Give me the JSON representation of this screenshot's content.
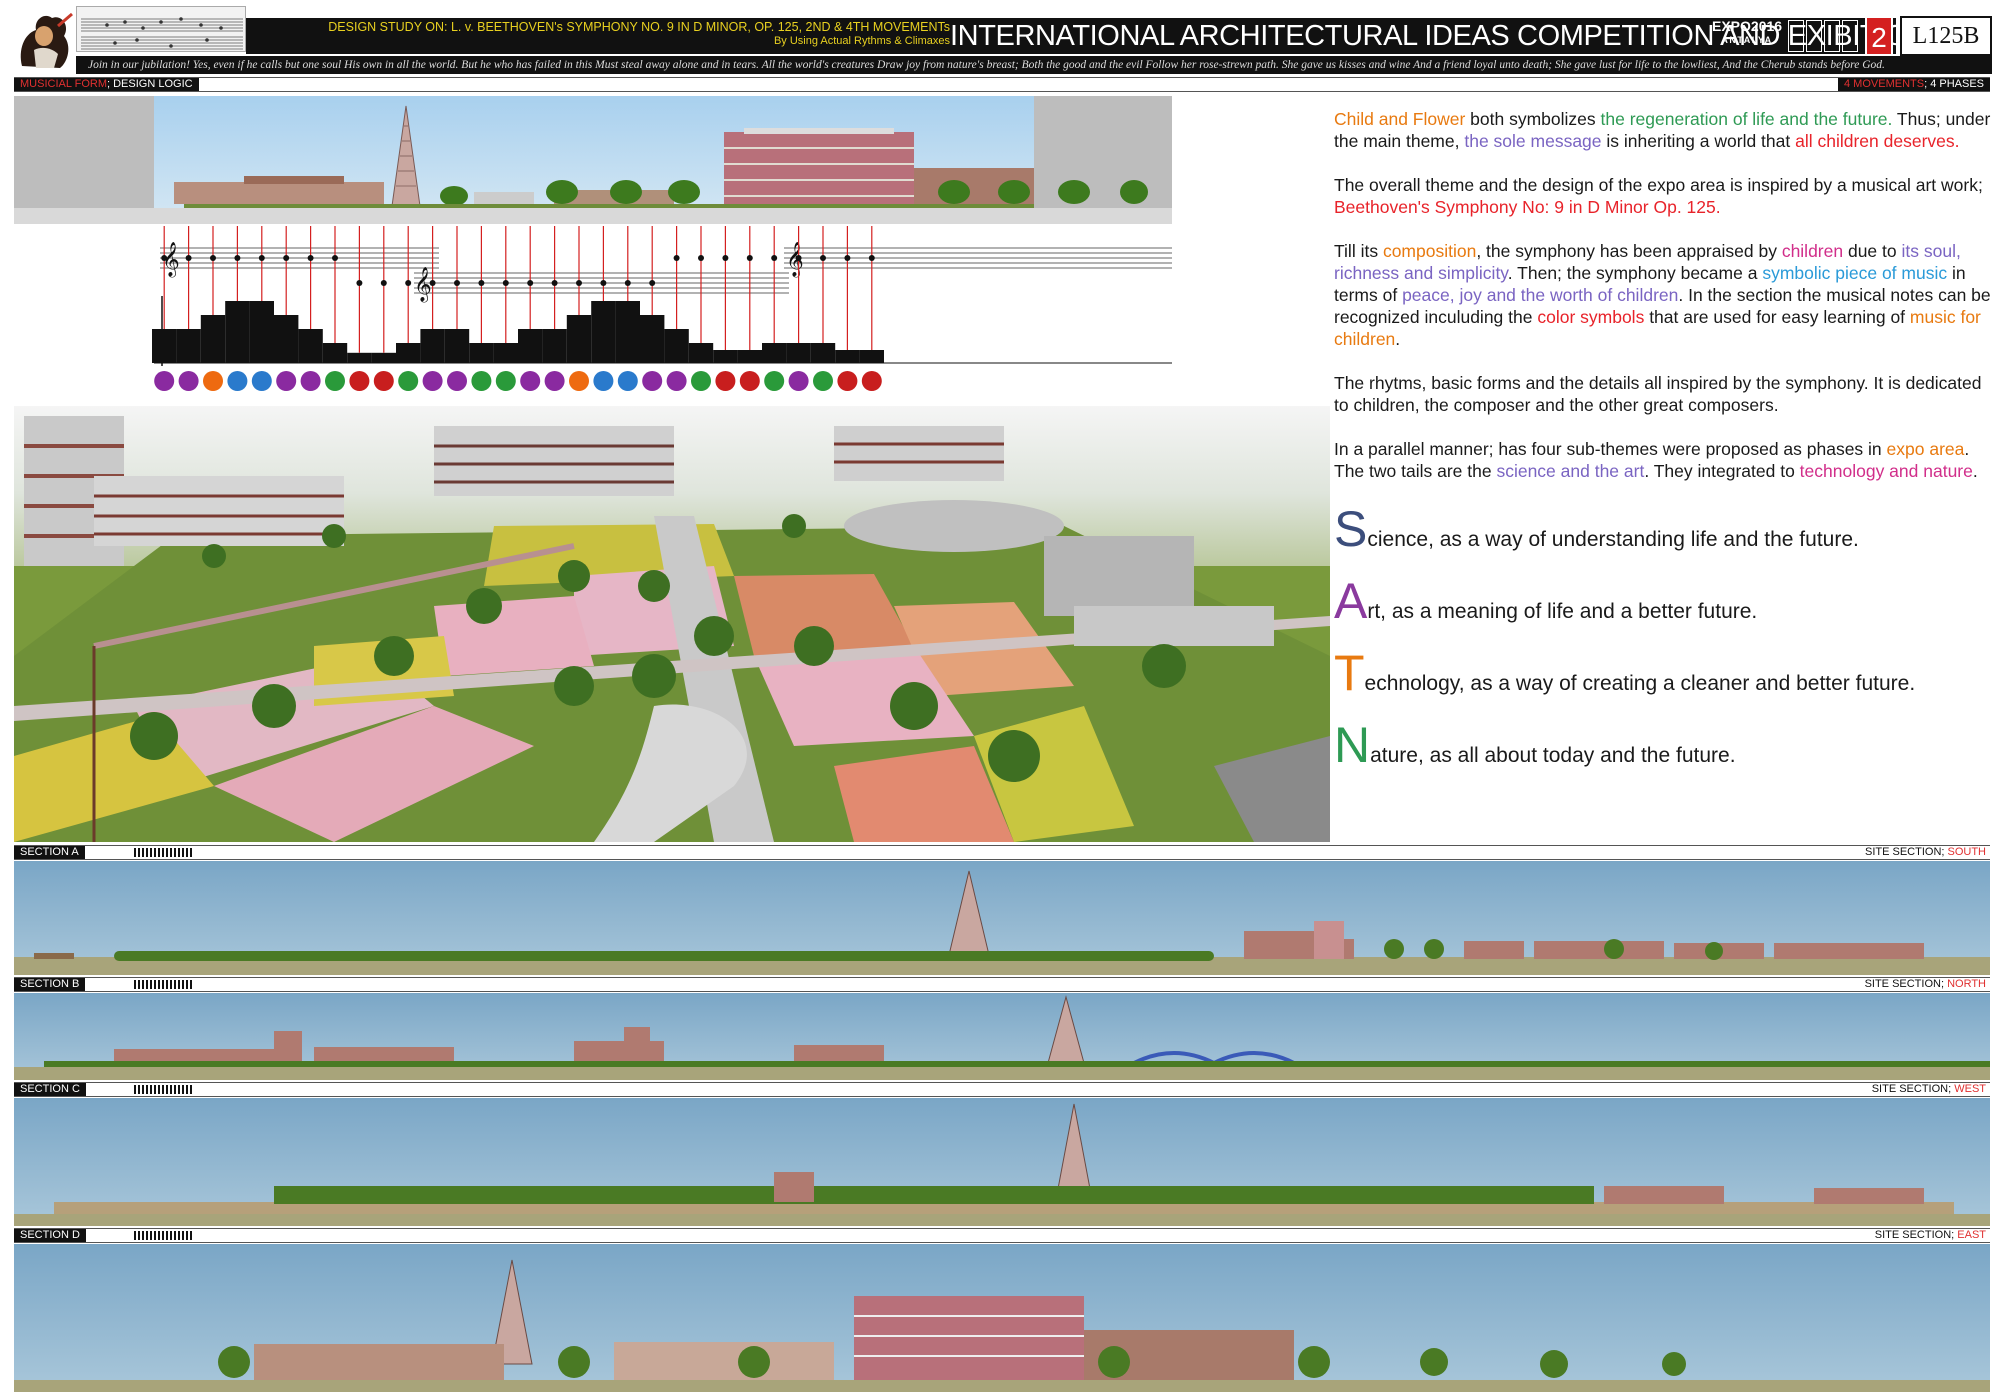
{
  "header": {
    "study_line": "DESIGN STUDY ON: L. v. BEETHOVEN's SYMPHONY NO. 9 IN D MINOR, OP. 125, 2ND & 4TH MOVEMENTs",
    "study_sub": "By Using Actual Rythms & Climaxes",
    "competition_title": "INTERNATIONAL ARCHITECTURAL IDEAS COMPETITION AND EXIBITION",
    "expo_year": "EXPO2016",
    "expo_city": "ANTALYA",
    "sheet_number": "2",
    "sheet_code": "L125B",
    "ode_text": "Join in our jubilation! Yes, even if he calls but one soul His own in all the world. But he who has failed in this Must steal away alone and in tears. All the world's creatures Draw joy from nature's breast; Both the good and the evil Follow her rose-strewn path. She gave us kisses and wine And a friend loyal unto death; She gave lust for life to the lowliest, And the Cherub stands before God."
  },
  "labels": {
    "top_left_a": "MUSICIAL FORM",
    "top_left_b": "; DESIGN LOGIC",
    "top_right_a": "4 MOVEMENTS",
    "top_right_b": "; 4 PHASES"
  },
  "text_panel": {
    "p1": [
      {
        "t": "Child and Flower",
        "c": "c-orange"
      },
      {
        "t": " both symbolizes ",
        "c": ""
      },
      {
        "t": "the regeneration of life and the future.",
        "c": "c-green"
      },
      {
        "t": " Thus; under the main theme, ",
        "c": ""
      },
      {
        "t": "the sole message",
        "c": "c-purple"
      },
      {
        "t": " is inheriting a world that ",
        "c": ""
      },
      {
        "t": "all children deserves.",
        "c": "c-red"
      }
    ],
    "p2": [
      {
        "t": "The overall theme and the design of the expo area is inspired by a musical art work; ",
        "c": ""
      },
      {
        "t": "Beethoven's Symphony No: 9 in D Minor Op. 125.",
        "c": "c-red"
      }
    ],
    "p3": [
      {
        "t": "Till its ",
        "c": ""
      },
      {
        "t": "composition",
        "c": "c-orange"
      },
      {
        "t": ", the symphony has been appraised by ",
        "c": ""
      },
      {
        "t": "children",
        "c": "c-magenta"
      },
      {
        "t": " due to ",
        "c": ""
      },
      {
        "t": "its soul, richness and simplicity",
        "c": "c-purple"
      },
      {
        "t": ". Then; the symphony became a ",
        "c": ""
      },
      {
        "t": "symbolic piece of music",
        "c": "c-blue"
      },
      {
        "t": " in terms of ",
        "c": ""
      },
      {
        "t": "peace, joy and the worth of children",
        "c": "c-purple"
      },
      {
        "t": ". In the section the musical notes can be recognized inculuding the ",
        "c": ""
      },
      {
        "t": "color symbols",
        "c": "c-red"
      },
      {
        "t": " that are used for easy learning of ",
        "c": ""
      },
      {
        "t": "music for children",
        "c": "c-orange"
      },
      {
        "t": ".",
        "c": ""
      }
    ],
    "p4": [
      {
        "t": "The rhytms, basic forms and the details all inspired by the symphony. It is dedicated to children, the composer and the other great composers.",
        "c": ""
      }
    ],
    "p5": [
      {
        "t": "In a parallel manner; has four sub-themes were proposed as phases in ",
        "c": ""
      },
      {
        "t": "expo area",
        "c": "c-orange"
      },
      {
        "t": ". The two tails are the ",
        "c": ""
      },
      {
        "t": "science and the art",
        "c": "c-purple"
      },
      {
        "t": ". They integrated to ",
        "c": ""
      },
      {
        "t": "technology and nature",
        "c": "c-magenta"
      },
      {
        "t": ".",
        "c": ""
      }
    ],
    "satn": [
      {
        "letter": "S",
        "rest": "cience, as a way of understanding life and the future.",
        "color": "#3c4e7c"
      },
      {
        "letter": "A",
        "rest": "rt, as a meaning of life and a better future.",
        "color": "#8a3a9e"
      },
      {
        "letter": "T",
        "rest": "echnology, as a way of creating a cleaner and better future.",
        "color": "#e87a10"
      },
      {
        "letter": "N",
        "rest": "ature, as all about today and the future.",
        "color": "#2e9a54"
      }
    ]
  },
  "sections": [
    {
      "label": "SECTION A",
      "right_a": "SITE SECTION; ",
      "right_b": "SOUTH"
    },
    {
      "label": "SECTION B",
      "right_a": "SITE SECTION; ",
      "right_b": "NORTH"
    },
    {
      "label": "SECTION C",
      "right_a": "SITE SECTION; ",
      "right_b": "WEST"
    },
    {
      "label": "SECTION D",
      "right_a": "SITE SECTION; ",
      "right_b": "EAST"
    }
  ],
  "music": {
    "dot_colors": [
      "#8a2aa0",
      "#8a2aa0",
      "#ee6a10",
      "#2a7acc",
      "#2a7acc",
      "#8a2aa0",
      "#8a2aa0",
      "#2a9a3a",
      "#c81e1e",
      "#c81e1e",
      "#2a9a3a",
      "#8a2aa0",
      "#8a2aa0",
      "#2a9a3a",
      "#2a9a3a",
      "#8a2aa0",
      "#8a2aa0",
      "#ee6a10",
      "#2a7acc",
      "#2a7acc",
      "#8a2aa0",
      "#8a2aa0",
      "#2a9a3a",
      "#c81e1e",
      "#c81e1e",
      "#2a9a3a",
      "#8a2aa0",
      "#2a9a3a",
      "#c81e1e",
      "#c81e1e"
    ],
    "bar_levels": [
      2,
      2,
      3,
      4,
      4,
      3,
      2,
      1,
      0.3,
      0.3,
      1,
      2,
      2,
      1,
      1,
      2,
      2,
      3,
      4,
      4,
      3,
      2,
      1,
      0.5,
      0.5,
      1,
      1,
      1,
      0.5,
      0.5
    ]
  },
  "colors": {
    "accent_red": "#e03030",
    "header_yellow": "#e8d020"
  }
}
